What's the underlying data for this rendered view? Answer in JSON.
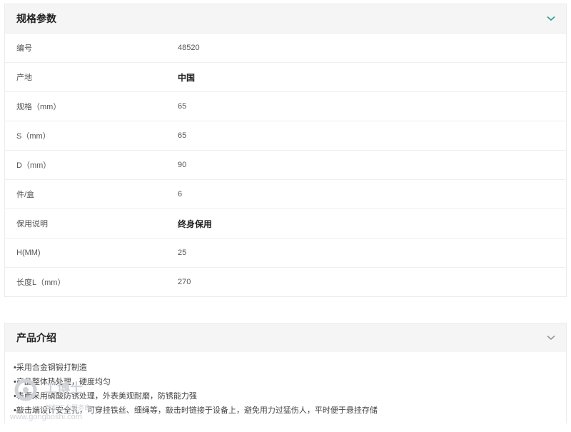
{
  "specs": {
    "title": "规格参数",
    "rows": [
      {
        "label": "编号",
        "value": "48520",
        "bold": false
      },
      {
        "label": "产地",
        "value": "中国",
        "bold": true
      },
      {
        "label": "规格（mm）",
        "value": "65",
        "bold": false
      },
      {
        "label": "S（mm）",
        "value": "65",
        "bold": false
      },
      {
        "label": "D（mm）",
        "value": "90",
        "bold": false
      },
      {
        "label": "件/盒",
        "value": "6",
        "bold": false
      },
      {
        "label": "保用说明",
        "value": "终身保用",
        "bold": true
      },
      {
        "label": "H(MM)",
        "value": "25",
        "bold": false
      },
      {
        "label": "长度L（mm）",
        "value": "270",
        "bold": false
      }
    ]
  },
  "intro": {
    "title": "产品介绍",
    "lines": [
      "•采用合金钢锻打制造",
      "•产品整体热处理，硬度均匀",
      "•表面采用磷酸防锈处理，外表美观耐磨，防锈能力强",
      "•敲击端设计安全孔，可穿挂铁丝、细绳等，敲击时链接于设备上，避免用力过猛伤人，平时便于悬挂存储"
    ]
  },
  "watermark": {
    "text_cn": "工博士",
    "text_sub": "智能工业服务商",
    "url": "www.gongboshi.com"
  },
  "colors": {
    "header_bg": "#f5f5f5",
    "chevron": "#2a9d8f",
    "border": "#ebebeb"
  }
}
